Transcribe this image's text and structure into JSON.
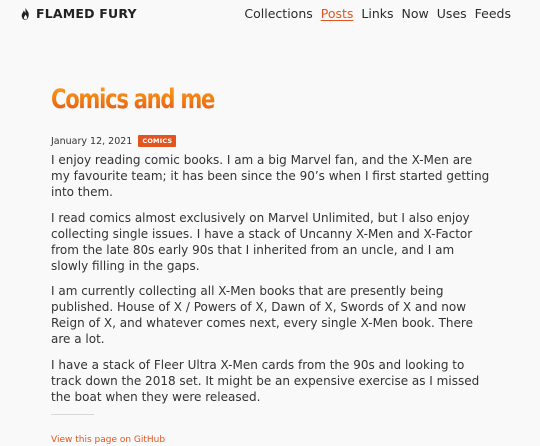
{
  "header": {
    "brand": "FLAMED FURY",
    "nav": [
      "Collections",
      "Posts",
      "Links",
      "Now",
      "Uses",
      "Feeds"
    ],
    "active_nav": "Posts",
    "accent_color": "#e2551f"
  },
  "post": {
    "title": "Comics and me",
    "date": "January 12, 2021",
    "tag": "COMICS",
    "paragraphs": [
      "I enjoy reading comic books. I am a big Marvel fan, and the X-Men are my favourite team; it has been since the 90’s when I first started getting into them.",
      "I read comics almost exclusively on Marvel Unlimited, but I also enjoy collecting single issues. I have a stack of Uncanny X-Men and X-Factor from the late 80s early 90s that I inherited from an uncle, and I am slowly filling in the gaps.",
      "I am currently collecting all X-Men books that are presently being published. House of X / Powers of X, Dawn of X, Swords of X and now Reign of X, and whatever comes next, every single X-Men book. There are a lot.",
      "I have a stack of Fleer Ultra X-Men cards from the 90s and looking to track down the 2018 set. It might be an expensive exercise as I missed the boat when they were released."
    ],
    "footer_link": "View this page on GitHub"
  }
}
